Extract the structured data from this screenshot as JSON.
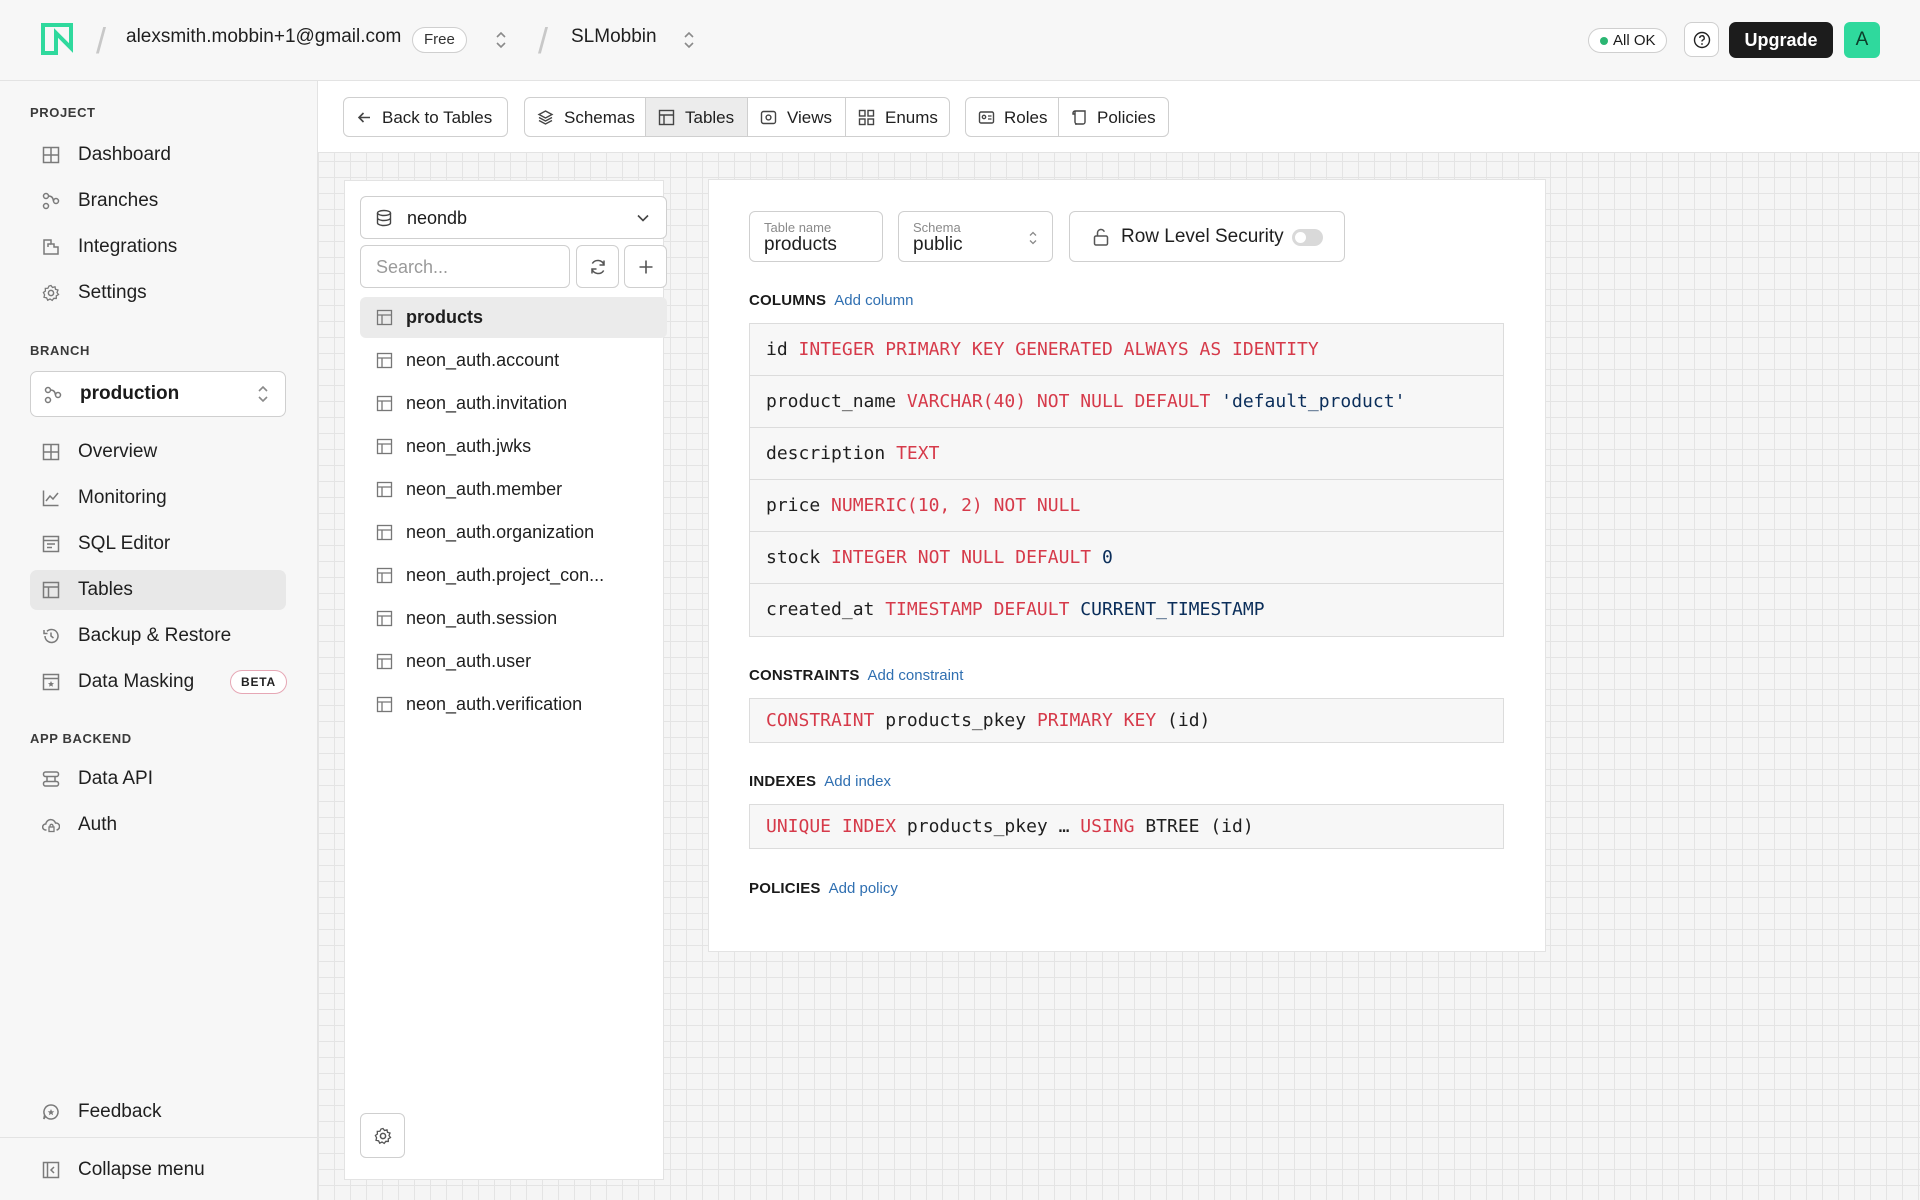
{
  "topbar": {
    "account_email": "alexsmith.mobbin+1@gmail.com",
    "plan_badge": "Free",
    "project_name": "SLMobbin",
    "status_text": "All OK",
    "upgrade_label": "Upgrade",
    "avatar_letter": "A",
    "colors": {
      "status_dot": "#2bb673",
      "avatar_bg": "#2fd99d",
      "logo": "#2fd99d"
    }
  },
  "sidebar": {
    "project_label": "PROJECT",
    "project_items": [
      {
        "label": "Dashboard",
        "icon": "dashboard-icon"
      },
      {
        "label": "Branches",
        "icon": "branches-icon"
      },
      {
        "label": "Integrations",
        "icon": "integrations-icon"
      },
      {
        "label": "Settings",
        "icon": "gear-icon"
      }
    ],
    "branch_label": "BRANCH",
    "branch_selected": "production",
    "branch_items": [
      {
        "label": "Overview",
        "icon": "overview-icon"
      },
      {
        "label": "Monitoring",
        "icon": "chart-line-icon"
      },
      {
        "label": "SQL Editor",
        "icon": "sql-editor-icon"
      },
      {
        "label": "Tables",
        "icon": "table-icon",
        "active": true
      },
      {
        "label": "Backup & Restore",
        "icon": "history-icon"
      },
      {
        "label": "Data Masking",
        "icon": "mask-icon",
        "badge": "BETA"
      }
    ],
    "backend_label": "APP BACKEND",
    "backend_items": [
      {
        "label": "Data API",
        "icon": "api-icon"
      },
      {
        "label": "Auth",
        "icon": "cloud-lock-icon"
      }
    ],
    "feedback_label": "Feedback",
    "collapse_label": "Collapse menu"
  },
  "toolbar": {
    "back_label": "Back to Tables",
    "tabs": [
      {
        "label": "Schemas",
        "icon": "layers-icon"
      },
      {
        "label": "Tables",
        "icon": "table-icon",
        "selected": true
      },
      {
        "label": "Views",
        "icon": "eye-icon"
      },
      {
        "label": "Enums",
        "icon": "grid-icon"
      },
      {
        "label": "Roles",
        "icon": "id-card-icon"
      },
      {
        "label": "Policies",
        "icon": "scroll-icon"
      }
    ]
  },
  "table_list": {
    "database": "neondb",
    "search_placeholder": "Search...",
    "tables": [
      {
        "name": "products",
        "active": true
      },
      {
        "name": "neon_auth.account"
      },
      {
        "name": "neon_auth.invitation"
      },
      {
        "name": "neon_auth.jwks"
      },
      {
        "name": "neon_auth.member"
      },
      {
        "name": "neon_auth.organization"
      },
      {
        "name": "neon_auth.project_con..."
      },
      {
        "name": "neon_auth.session"
      },
      {
        "name": "neon_auth.user"
      },
      {
        "name": "neon_auth.verification"
      }
    ]
  },
  "editor": {
    "table_name_label": "Table name",
    "table_name_value": "products",
    "schema_label": "Schema",
    "schema_value": "public",
    "rls_label": "Row Level Security",
    "rls_enabled": false,
    "columns_title": "COLUMNS",
    "add_column": "Add column",
    "columns": [
      [
        {
          "t": "id",
          "c": "idn"
        },
        {
          "t": "INTEGER PRIMARY KEY GENERATED ALWAYS AS IDENTITY",
          "c": "kw"
        }
      ],
      [
        {
          "t": "product_name",
          "c": "idn"
        },
        {
          "t": "VARCHAR(40) NOT NULL DEFAULT",
          "c": "kw"
        },
        {
          "t": "'default_product'",
          "c": "lit"
        }
      ],
      [
        {
          "t": "description",
          "c": "idn"
        },
        {
          "t": "TEXT",
          "c": "kw"
        }
      ],
      [
        {
          "t": "price",
          "c": "idn"
        },
        {
          "t": "NUMERIC(10, 2) NOT NULL",
          "c": "kw"
        }
      ],
      [
        {
          "t": "stock",
          "c": "idn"
        },
        {
          "t": "INTEGER NOT NULL DEFAULT",
          "c": "kw"
        },
        {
          "t": "0",
          "c": "lit"
        }
      ],
      [
        {
          "t": "created_at",
          "c": "idn"
        },
        {
          "t": "TIMESTAMP DEFAULT",
          "c": "kw"
        },
        {
          "t": "CURRENT_TIMESTAMP",
          "c": "lit"
        }
      ]
    ],
    "constraints_title": "CONSTRAINTS",
    "add_constraint": "Add constraint",
    "constraints": [
      [
        {
          "t": "CONSTRAINT",
          "c": "kw"
        },
        {
          "t": "products_pkey",
          "c": "idn"
        },
        {
          "t": "PRIMARY KEY",
          "c": "kw"
        },
        {
          "t": "(id)",
          "c": "idn"
        }
      ]
    ],
    "indexes_title": "INDEXES",
    "add_index": "Add index",
    "indexes": [
      [
        {
          "t": "UNIQUE INDEX",
          "c": "kw"
        },
        {
          "t": "products_pkey …",
          "c": "idn"
        },
        {
          "t": "USING",
          "c": "kw"
        },
        {
          "t": "BTREE (id)",
          "c": "idn"
        }
      ]
    ],
    "policies_title": "POLICIES",
    "add_policy": "Add policy"
  }
}
